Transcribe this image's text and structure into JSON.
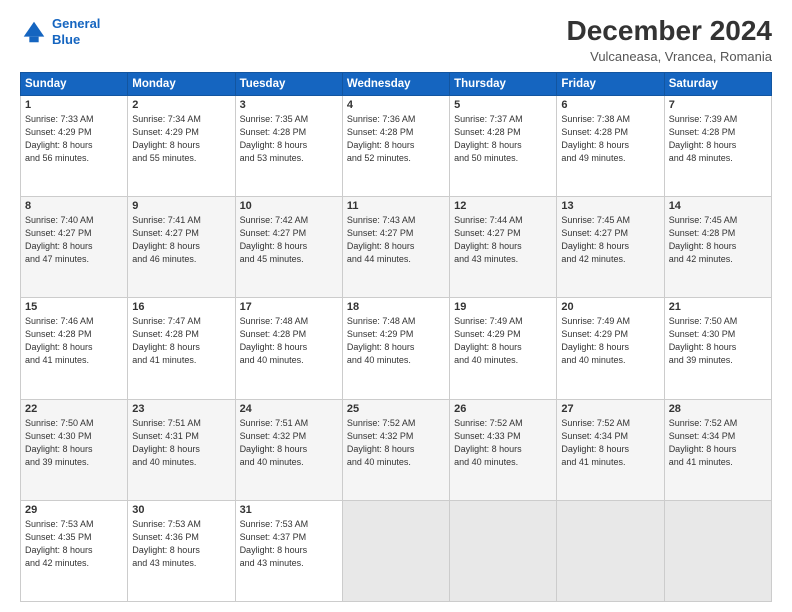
{
  "header": {
    "logo_line1": "General",
    "logo_line2": "Blue",
    "title": "December 2024",
    "subtitle": "Vulcaneasa, Vrancea, Romania"
  },
  "columns": [
    "Sunday",
    "Monday",
    "Tuesday",
    "Wednesday",
    "Thursday",
    "Friday",
    "Saturday"
  ],
  "weeks": [
    [
      {
        "day": "1",
        "info": "Sunrise: 7:33 AM\nSunset: 4:29 PM\nDaylight: 8 hours\nand 56 minutes."
      },
      {
        "day": "2",
        "info": "Sunrise: 7:34 AM\nSunset: 4:29 PM\nDaylight: 8 hours\nand 55 minutes."
      },
      {
        "day": "3",
        "info": "Sunrise: 7:35 AM\nSunset: 4:28 PM\nDaylight: 8 hours\nand 53 minutes."
      },
      {
        "day": "4",
        "info": "Sunrise: 7:36 AM\nSunset: 4:28 PM\nDaylight: 8 hours\nand 52 minutes."
      },
      {
        "day": "5",
        "info": "Sunrise: 7:37 AM\nSunset: 4:28 PM\nDaylight: 8 hours\nand 50 minutes."
      },
      {
        "day": "6",
        "info": "Sunrise: 7:38 AM\nSunset: 4:28 PM\nDaylight: 8 hours\nand 49 minutes."
      },
      {
        "day": "7",
        "info": "Sunrise: 7:39 AM\nSunset: 4:28 PM\nDaylight: 8 hours\nand 48 minutes."
      }
    ],
    [
      {
        "day": "8",
        "info": "Sunrise: 7:40 AM\nSunset: 4:27 PM\nDaylight: 8 hours\nand 47 minutes."
      },
      {
        "day": "9",
        "info": "Sunrise: 7:41 AM\nSunset: 4:27 PM\nDaylight: 8 hours\nand 46 minutes."
      },
      {
        "day": "10",
        "info": "Sunrise: 7:42 AM\nSunset: 4:27 PM\nDaylight: 8 hours\nand 45 minutes."
      },
      {
        "day": "11",
        "info": "Sunrise: 7:43 AM\nSunset: 4:27 PM\nDaylight: 8 hours\nand 44 minutes."
      },
      {
        "day": "12",
        "info": "Sunrise: 7:44 AM\nSunset: 4:27 PM\nDaylight: 8 hours\nand 43 minutes."
      },
      {
        "day": "13",
        "info": "Sunrise: 7:45 AM\nSunset: 4:27 PM\nDaylight: 8 hours\nand 42 minutes."
      },
      {
        "day": "14",
        "info": "Sunrise: 7:45 AM\nSunset: 4:28 PM\nDaylight: 8 hours\nand 42 minutes."
      }
    ],
    [
      {
        "day": "15",
        "info": "Sunrise: 7:46 AM\nSunset: 4:28 PM\nDaylight: 8 hours\nand 41 minutes."
      },
      {
        "day": "16",
        "info": "Sunrise: 7:47 AM\nSunset: 4:28 PM\nDaylight: 8 hours\nand 41 minutes."
      },
      {
        "day": "17",
        "info": "Sunrise: 7:48 AM\nSunset: 4:28 PM\nDaylight: 8 hours\nand 40 minutes."
      },
      {
        "day": "18",
        "info": "Sunrise: 7:48 AM\nSunset: 4:29 PM\nDaylight: 8 hours\nand 40 minutes."
      },
      {
        "day": "19",
        "info": "Sunrise: 7:49 AM\nSunset: 4:29 PM\nDaylight: 8 hours\nand 40 minutes."
      },
      {
        "day": "20",
        "info": "Sunrise: 7:49 AM\nSunset: 4:29 PM\nDaylight: 8 hours\nand 40 minutes."
      },
      {
        "day": "21",
        "info": "Sunrise: 7:50 AM\nSunset: 4:30 PM\nDaylight: 8 hours\nand 39 minutes."
      }
    ],
    [
      {
        "day": "22",
        "info": "Sunrise: 7:50 AM\nSunset: 4:30 PM\nDaylight: 8 hours\nand 39 minutes."
      },
      {
        "day": "23",
        "info": "Sunrise: 7:51 AM\nSunset: 4:31 PM\nDaylight: 8 hours\nand 40 minutes."
      },
      {
        "day": "24",
        "info": "Sunrise: 7:51 AM\nSunset: 4:32 PM\nDaylight: 8 hours\nand 40 minutes."
      },
      {
        "day": "25",
        "info": "Sunrise: 7:52 AM\nSunset: 4:32 PM\nDaylight: 8 hours\nand 40 minutes."
      },
      {
        "day": "26",
        "info": "Sunrise: 7:52 AM\nSunset: 4:33 PM\nDaylight: 8 hours\nand 40 minutes."
      },
      {
        "day": "27",
        "info": "Sunrise: 7:52 AM\nSunset: 4:34 PM\nDaylight: 8 hours\nand 41 minutes."
      },
      {
        "day": "28",
        "info": "Sunrise: 7:52 AM\nSunset: 4:34 PM\nDaylight: 8 hours\nand 41 minutes."
      }
    ],
    [
      {
        "day": "29",
        "info": "Sunrise: 7:53 AM\nSunset: 4:35 PM\nDaylight: 8 hours\nand 42 minutes."
      },
      {
        "day": "30",
        "info": "Sunrise: 7:53 AM\nSunset: 4:36 PM\nDaylight: 8 hours\nand 43 minutes."
      },
      {
        "day": "31",
        "info": "Sunrise: 7:53 AM\nSunset: 4:37 PM\nDaylight: 8 hours\nand 43 minutes."
      },
      {
        "day": "",
        "info": ""
      },
      {
        "day": "",
        "info": ""
      },
      {
        "day": "",
        "info": ""
      },
      {
        "day": "",
        "info": ""
      }
    ]
  ]
}
